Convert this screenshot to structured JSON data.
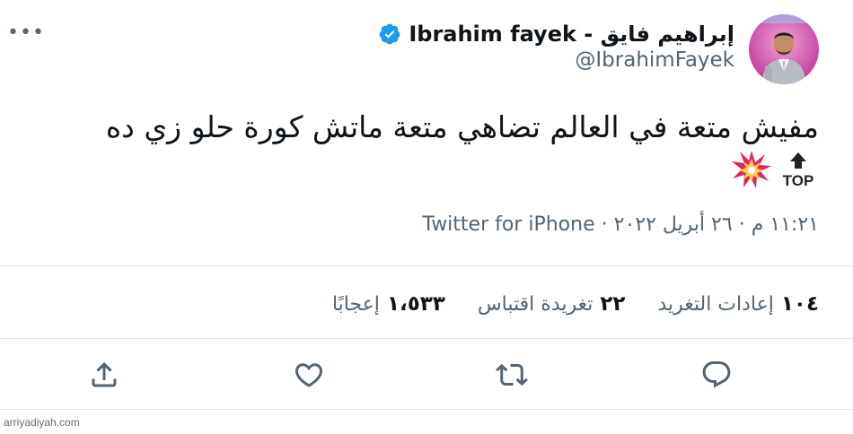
{
  "tweet": {
    "author": {
      "display_name": "إبراهيم فايق - Ibrahim fayek",
      "handle": "@IbrahimFayek",
      "verified": true
    },
    "text": "مفيش متعة في العالم تضاهي متعة ماتش كورة حلو زي ده",
    "emoji": [
      "collision",
      "top-arrow"
    ],
    "top_label": "TOP",
    "meta": {
      "time": "١١:٢١ م",
      "separator": "·",
      "date": "٢٦ أبريل ٢٠٢٢",
      "source": "Twitter for iPhone"
    },
    "stats": {
      "retweets": {
        "value": "١٠٤",
        "label": "إعادات التغريد"
      },
      "quotes": {
        "value": "٢٢",
        "label": "تغريدة اقتباس"
      },
      "likes": {
        "value": "١،٥٣٣",
        "label": "إعجابًا"
      }
    },
    "actions": [
      "reply-icon",
      "retweet-icon",
      "like-icon",
      "share-icon"
    ],
    "colors": {
      "text": "#0f1419",
      "secondary": "#536471",
      "verified": "#1d9bf0",
      "divider": "#dfe3e6"
    }
  },
  "watermark": "arriyadiyah.com"
}
